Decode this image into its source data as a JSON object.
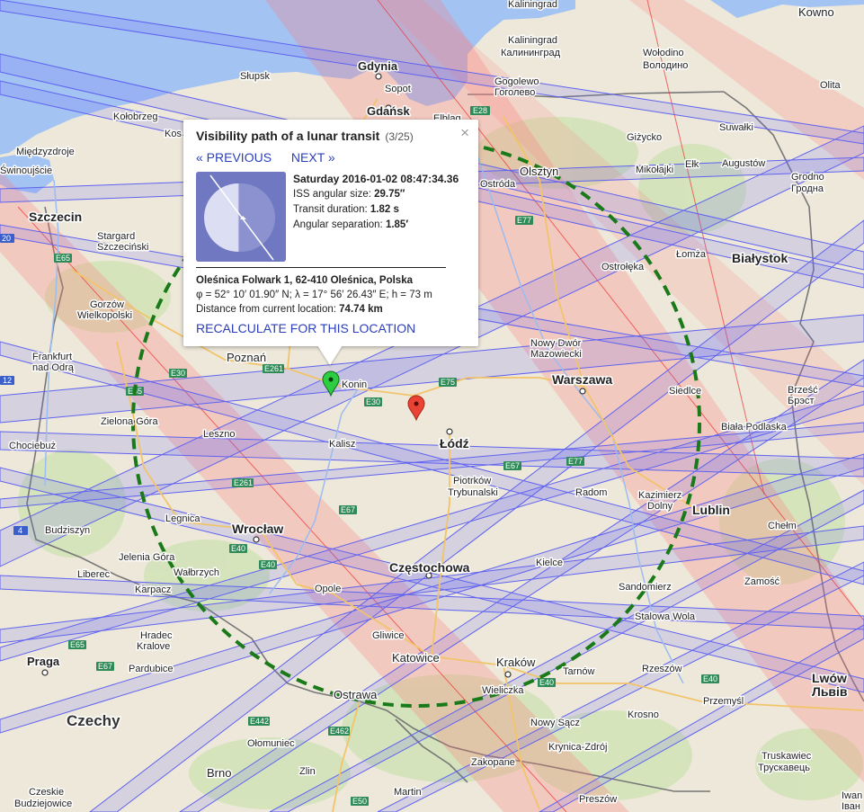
{
  "popup": {
    "title": "Visibility path of a lunar transit",
    "counter": "(3/25)",
    "close": "×",
    "prev": "« PREVIOUS",
    "next": "NEXT »",
    "date": "Saturday 2016-01-02 08:47:34.36",
    "size_label": "ISS angular size:",
    "size_value": "29.75′′",
    "duration_label": "Transit duration:",
    "duration_value": "1.82 s",
    "sep_label": "Angular separation:",
    "sep_value": "1.85′",
    "address": "Oleśnica Folwark 1, 62-410 Oleśnica, Polska",
    "coords": "φ = 52° 10′ 01.90″ N; λ = 17° 56′ 26.43″ E; h = 73 m",
    "distance_label": "Distance from current location:",
    "distance_value": "74.74 km",
    "recalc": "RECALCULATE FOR THIS LOCATION"
  },
  "places": {
    "kowno": "Kowno",
    "slupsk": "Słupsk",
    "gdynia": "Gdynia",
    "sopot": "Sopot",
    "gdansk": "Gdańsk",
    "elblag": "Elbląg",
    "kaliningrad": "Kaliningrad",
    "kaliningrad_ru": "Калининград",
    "wolodino": "Wołodino",
    "wolodino_ru": "Володино",
    "gogolewo": "Gogolewo",
    "gogolewo_ru": "Гоголево",
    "olita": "Olita",
    "kolobrzeg": "Kołobrzeg",
    "koszalin": "Kos",
    "miedzyzdroje": "Międzyzdroje",
    "swinoujscie": "Świnoujście",
    "suwalki": "Suwałki",
    "gizycko": "Giżycko",
    "mikolajki": "Mikołajki",
    "elk": "Ełk",
    "augustow": "Augustów",
    "grodno": "Grodno",
    "grodno_ru": "Гродна",
    "olsztyn": "Olsztyn",
    "ostroda": "Ostróda",
    "szczecin": "Szczecin",
    "stargard": "Stargard",
    "stargard2": "Szczeciński",
    "lomza": "Łomża",
    "ostroleka": "Ostrołęka",
    "bialystok": "Białystok",
    "gorzow": "Gorzów",
    "gorzow2": "Wielkopolski",
    "frankfurt": "Frankfurt",
    "frankfurt2": "nad Odrą",
    "poznan": "Poznań",
    "konin": "Konin",
    "nowy_dwor": "Nowy Dwór",
    "nowy_dwor2": "Mazowiecki",
    "warszawa": "Warszawa",
    "siedlce": "Siedlce",
    "brzesc": "Brześć",
    "brzesc_ru": "Брэст",
    "zielona_gora": "Zielona Góra",
    "leszno": "Leszno",
    "kalisz": "Kalisz",
    "lodz": "Łódź",
    "biala_podlaska": "Biała Podlaska",
    "chociebuz": "Chociebuż",
    "piotrkow": "Piotrków",
    "piotrkow2": "Trybunalski",
    "radom": "Radom",
    "kazimierz": "Kazimierz",
    "kazimierz2": "Dolny",
    "lublin": "Lublin",
    "legnica": "Legnica",
    "wroclaw": "Wrocław",
    "budziszyn": "Budziszyn",
    "chelm": "Chełm",
    "jelenia_gora": "Jelenia Góra",
    "walbrzych": "Wałbrzych",
    "liberec": "Liberec",
    "karpacz": "Karpacz",
    "czestochowa": "Częstochowa",
    "kielce": "Kielce",
    "opole": "Opole",
    "sandomierz": "Sandomierz",
    "zamosc": "Zamość",
    "stalowa_wola": "Stalowa Wola",
    "hradec": "Hradec",
    "hradec2": "Kralove",
    "gliwice": "Gliwice",
    "praga": "Praga",
    "pardubice": "Pardubice",
    "katowice": "Katowice",
    "krakow": "Kraków",
    "tarnow": "Tarnów",
    "rzeszow": "Rzeszów",
    "lwow": "Lwów",
    "lwow_ru": "Львів",
    "wieliczka": "Wieliczka",
    "czechy": "Czechy",
    "ostrawa": "Ostrawa",
    "przemysl": "Przemyśl",
    "nowy_sacz": "Nowy Sącz",
    "krosno": "Krosno",
    "olomuniec": "Ołomuniec",
    "krynica": "Krynica-Zdrój",
    "truskawiec": "Truskawiec",
    "truskawiec_ru": "Трускавець",
    "brno": "Brno",
    "zlin": "Zlin",
    "zakopane": "Zakopane",
    "czeskie": "Czeskie",
    "czeskie2": "Budziejowice",
    "martin": "Martin",
    "preszow": "Preszów",
    "iwano": "Iwan",
    "iwano2": "Іван"
  },
  "roads": {
    "e28": "E28",
    "e77a": "E77",
    "e65a": "E65",
    "e65b": "E65",
    "e30a": "E30",
    "e30b": "E30",
    "e261a": "E261",
    "e261b": "E261",
    "e75": "E75",
    "e67a": "E67",
    "e67b": "E67",
    "e67c": "E67",
    "e77b": "E77",
    "e40a": "E40",
    "e40b": "E40",
    "e40c": "E40",
    "e40d": "E40",
    "e462": "E462",
    "e442": "E442",
    "e50": "E50",
    "e65c": "E65",
    "e65d": "E65",
    "n20": "20",
    "n12": "12",
    "n4": "4"
  },
  "markers": {
    "green": "green-marker",
    "red": "red-marker"
  },
  "colors": {
    "water": "#a3c3f3",
    "land": "#ece7d8",
    "path_blue": "#6a6cf4",
    "path_red": "#ff8a8a",
    "circle": "#1a7a1a"
  }
}
